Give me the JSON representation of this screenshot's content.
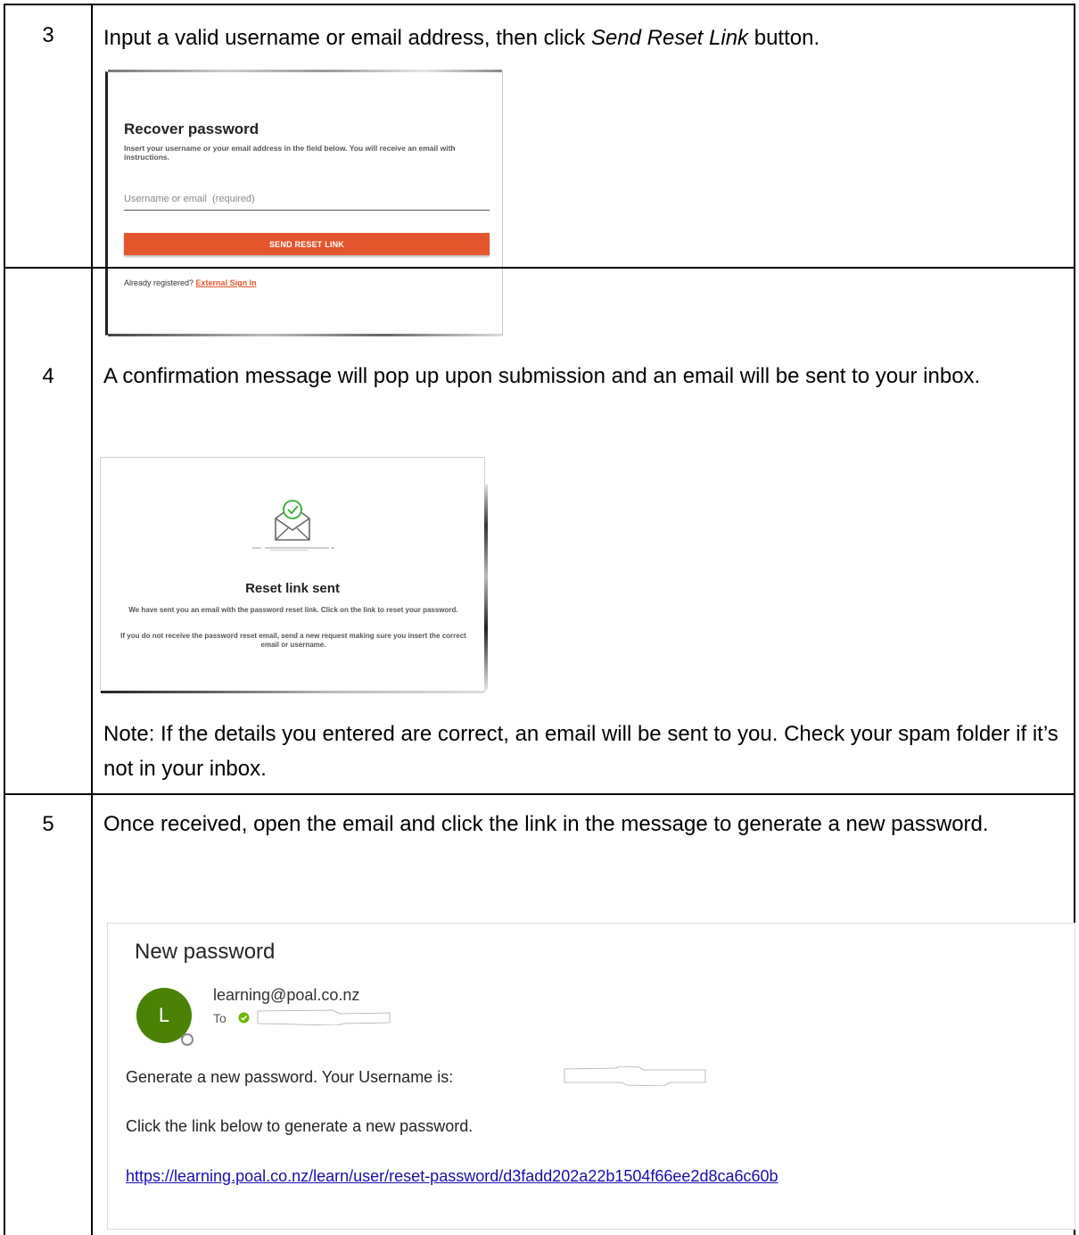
{
  "steps": [
    {
      "number": "3",
      "text_before": "Input a valid username or email address, then click ",
      "text_emph": "Send Reset Link",
      "text_after": " button."
    },
    {
      "number": "4",
      "text": "A confirmation message will pop up upon submission and an email will be sent to your inbox.",
      "note": "Note: If the details you entered are correct, an email will be sent to you. Check your spam folder if it’s not in your inbox."
    },
    {
      "number": "5",
      "text": "Once received, open the email and click the link in the message to generate a new password."
    }
  ],
  "recover_form": {
    "title": "Recover password",
    "description": "Insert your username or your email address in the field below. You will receive an email with instructions.",
    "input_value": "",
    "input_placeholder": "Username or email  (required)",
    "button_label": "SEND RESET LINK",
    "footer_text": "Already registered? ",
    "footer_link": "External Sign In",
    "accent_color": "#e4572e"
  },
  "reset_sent": {
    "icon": "envelope-check-icon",
    "title": "Reset link sent",
    "para1": "We have sent you an email with the password reset link. Click on the link to reset your password.",
    "para2": "If you do not receive the password reset email, send a new request making sure you insert the correct email or username.",
    "check_color": "#3aaa35"
  },
  "email": {
    "subject": "New password",
    "avatar_letter": "L",
    "avatar_color": "#498205",
    "sender": "learning@poal.co.nz",
    "to_label": "To",
    "body_line1": "Generate a new password. Your Username is:",
    "body_line2": "Click the link below to generate a new password.",
    "link": "https://learning.poal.co.nz/learn/user/reset-password/d3fadd202a22b1504f66ee2d8ca6c60b",
    "link_color": "#1a0dab"
  }
}
